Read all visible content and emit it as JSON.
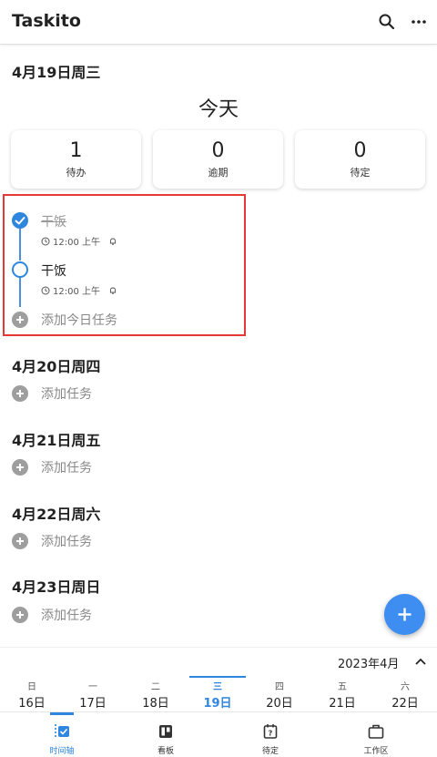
{
  "app": {
    "title": "Taskito"
  },
  "today": {
    "date_header": "4月19日周三",
    "section_title": "今天",
    "stats": [
      {
        "value": "1",
        "label": "待办"
      },
      {
        "value": "0",
        "label": "逾期"
      },
      {
        "value": "0",
        "label": "待定"
      }
    ],
    "tasks": [
      {
        "title": "干饭",
        "time": "12:00 上午",
        "done": true
      },
      {
        "title": "干饭",
        "time": "12:00 上午",
        "done": false
      }
    ],
    "add_label": "添加今日任务"
  },
  "upcoming": [
    {
      "date": "4月20日周四",
      "add_label": "添加任务"
    },
    {
      "date": "4月21日周五",
      "add_label": "添加任务"
    },
    {
      "date": "4月22日周六",
      "add_label": "添加任务"
    },
    {
      "date": "4月23日周日",
      "add_label": "添加任务"
    }
  ],
  "calendar": {
    "month": "2023年4月",
    "days": [
      {
        "week": "日",
        "day": "16日"
      },
      {
        "week": "一",
        "day": "17日"
      },
      {
        "week": "二",
        "day": "18日"
      },
      {
        "week": "三",
        "day": "19日",
        "selected": true
      },
      {
        "week": "四",
        "day": "20日"
      },
      {
        "week": "五",
        "day": "21日"
      },
      {
        "week": "六",
        "day": "22日"
      }
    ]
  },
  "nav": [
    {
      "label": "时间轴",
      "icon": "timeline-icon",
      "active": true
    },
    {
      "label": "看板",
      "icon": "board-icon"
    },
    {
      "label": "待定",
      "icon": "pending-icon"
    },
    {
      "label": "工作区",
      "icon": "workspace-icon"
    }
  ],
  "colors": {
    "accent": "#2e86de",
    "fab": "#3d8ef0",
    "highlight": "#e53935"
  }
}
